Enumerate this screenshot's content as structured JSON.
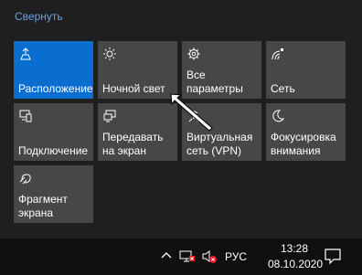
{
  "panel": {
    "collapse_label": "Свернуть"
  },
  "tiles": [
    {
      "label": "Расположение",
      "icon": "location-icon",
      "active": true
    },
    {
      "label": "Ночной свет",
      "icon": "night-light-icon",
      "active": false
    },
    {
      "label": "Все параметры",
      "icon": "gear-icon",
      "active": false
    },
    {
      "label": "Сеть",
      "icon": "network-icon",
      "active": false
    },
    {
      "label": "Подключение",
      "icon": "connect-icon",
      "active": false
    },
    {
      "label": "Передавать на экран",
      "icon": "project-icon",
      "active": false
    },
    {
      "label": "Виртуальная сеть (VPN)",
      "icon": "vpn-icon",
      "active": false
    },
    {
      "label": "Фокусировка внимания",
      "icon": "focus-assist-icon",
      "active": false
    },
    {
      "label": "Фрагмент экрана",
      "icon": "snip-icon",
      "active": false
    }
  ],
  "taskbar": {
    "language": "РУС",
    "time": "13:28",
    "date": "08.10.2020"
  },
  "colors": {
    "accent": "#0a6ed1",
    "tile_bg": "#474747",
    "panel_bg": "#1f1f1f",
    "link": "#6ca0e4",
    "taskbar_bg": "#101010"
  }
}
